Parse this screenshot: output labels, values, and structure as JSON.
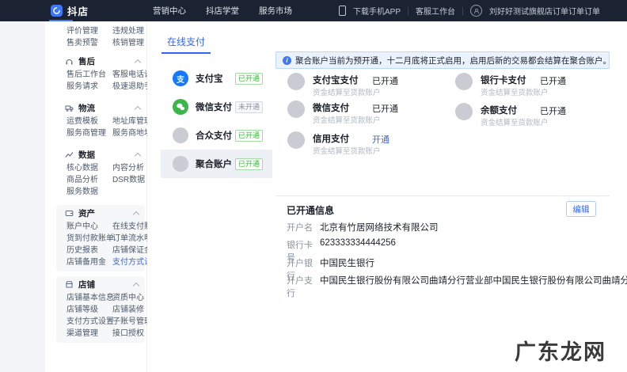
{
  "navbar": {
    "brand": "抖店",
    "menu": [
      "营销中心",
      "抖店学堂",
      "服务市场"
    ],
    "download_app": "下载手机APP",
    "workbench": "客服工作台",
    "account": "刘好好测试旗舰店订单订单订单"
  },
  "sidebar": {
    "top_rows": [
      [
        "评价管理",
        "违规处理"
      ],
      [
        "售卖预警",
        "核销管理"
      ]
    ],
    "sections": [
      {
        "title": "售后",
        "rows": [
          [
            "售后工作台",
            "客服电话设置"
          ],
          [
            "服务请求",
            "极速退助手"
          ]
        ]
      },
      {
        "title": "物流",
        "rows": [
          [
            "运费模板",
            "地址库管理"
          ],
          [
            "服务商管理",
            "服务商地址"
          ]
        ]
      },
      {
        "title": "数据",
        "rows": [
          [
            "核心数据",
            "内容分析"
          ],
          [
            "商品分析",
            "DSR数据"
          ],
          [
            "服务数据",
            ""
          ]
        ]
      },
      {
        "title": "资产",
        "rows": [
          [
            "账户中心",
            "在线支付账单"
          ],
          [
            "货到付款账单",
            "订单流水明细"
          ],
          [
            "历史报表",
            "店铺保证金"
          ],
          [
            "店铺备用金",
            "支付方式设置"
          ]
        ]
      },
      {
        "title": "店铺",
        "rows": [
          [
            "店铺基本信息",
            "资质中心"
          ],
          [
            "店铺等级",
            "店铺装修"
          ],
          [
            "支付方式设置",
            "子账号管理"
          ],
          [
            "渠道管理",
            "接口授权"
          ]
        ]
      }
    ]
  },
  "main": {
    "tab": "在线支付",
    "notice": "聚合账户当前为预开通，十二月底将正式启用，启用后新的交易都会结算在聚合账户。",
    "methods": [
      {
        "name": "支付宝",
        "badge": "已开通"
      },
      {
        "name": "微信支付",
        "badge": "未开通"
      },
      {
        "name": "合众支付",
        "badge": "已开通"
      },
      {
        "name": "聚合账户",
        "badge": "已开通"
      }
    ],
    "channels": [
      {
        "name": "支付宝支付",
        "desc": "资金结算至货款账户",
        "status": "已开通"
      },
      {
        "name": "银行卡支付",
        "desc": "资金结算至货款账户",
        "status": "已开通"
      },
      {
        "name": "微信支付",
        "desc": "资金结算至货款账户",
        "status": "已开通"
      },
      {
        "name": "余额支付",
        "desc": "资金结算至货款账户",
        "status": "已开通"
      },
      {
        "name": "信用支付",
        "desc": "资金结算至货款账户",
        "status": "开通"
      }
    ],
    "opened_info": {
      "title": "已开通信息",
      "edit_label": "编辑",
      "rows": [
        {
          "label": "开户名",
          "value": "北京有竹居网络技术有限公司"
        },
        {
          "label": "银行卡号",
          "value": "623333334444256"
        },
        {
          "label": "开户银行",
          "value": "中国民生银行"
        },
        {
          "label": "开户支行",
          "value": "中国民生银行股份有限公司曲靖分行营业部中国民生银行股份有限公司曲靖分行营业部"
        }
      ]
    }
  },
  "watermark": "广东龙网",
  "colors": {
    "accent": "#3365f2",
    "green": "#43b244",
    "navbar_bg": "#1b2332",
    "banner_bg": "#e9f2fe"
  }
}
